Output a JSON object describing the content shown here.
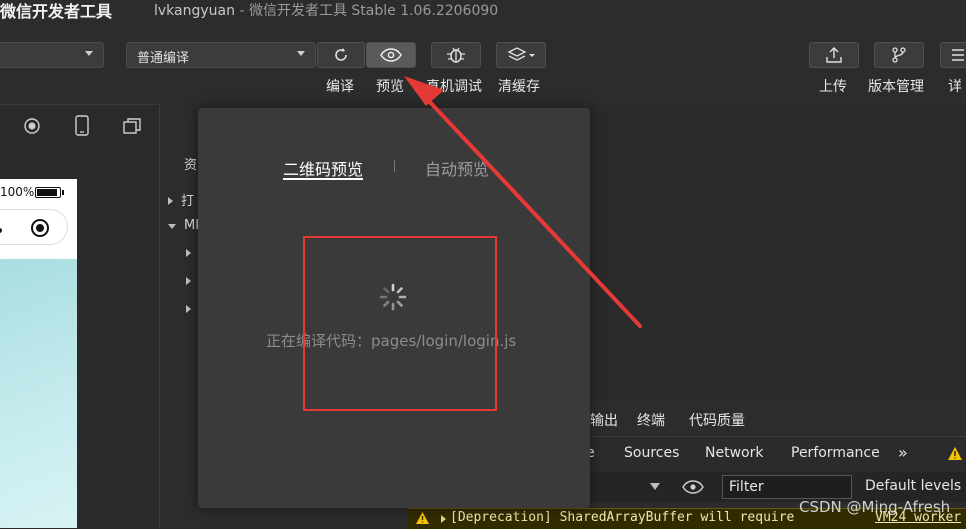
{
  "window": {
    "app_title": "微信开发者工具",
    "user": "lvkangyuan",
    "separator": " - ",
    "version_info": "微信开发者工具 Stable 1.06.2206090"
  },
  "toolbar": {
    "compile_mode": "普通编译",
    "compile_label": "编译",
    "preview_label": "预览",
    "remote_debug_label": "真机调试",
    "clear_cache_label": "清缓存",
    "upload_label": "上传",
    "version_mgmt_label": "版本管理",
    "details_label": "详"
  },
  "simulator": {
    "battery_pct": "100%"
  },
  "tree": {
    "row1": "资",
    "row2": "打",
    "row3": "MI"
  },
  "preview_popup": {
    "tab_qr": "二维码预览",
    "tab_auto": "自动预览",
    "status_text": "正在编译代码：pages/login/login.js"
  },
  "bottom_panel": {
    "tab_output": "输出",
    "tab_terminal": "终端",
    "tab_quality": "代码质量"
  },
  "devtools": {
    "tab_partial": "e",
    "tab_sources": "Sources",
    "tab_network": "Network",
    "tab_performance": "Performance",
    "more": "»",
    "filter_placeholder": "Filter",
    "levels": "Default levels",
    "console_msg": "[Deprecation] SharedArrayBuffer will require",
    "console_source": "VM24 worker"
  },
  "watermark": "CSDN @Ming-Afresh",
  "colors": {
    "annotation_red": "#e53935",
    "warning_yellow": "#f5c400"
  }
}
